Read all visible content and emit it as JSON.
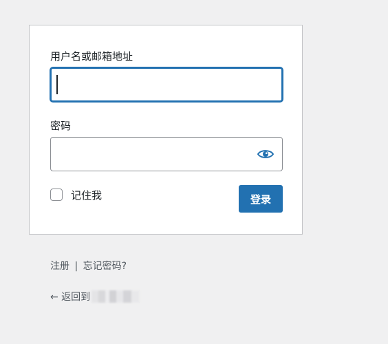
{
  "login_form": {
    "username_label": "用户名或邮箱地址",
    "username_value": "",
    "password_label": "密码",
    "password_value": "",
    "remember_label": "记住我",
    "remember_checked": false,
    "submit_label": "登录"
  },
  "nav": {
    "register_label": "注册",
    "separator": "|",
    "lost_password_label": "忘记密码?",
    "back_to_site_label": "← 返回到"
  },
  "colors": {
    "accent": "#2271b1",
    "background": "#f0f0f1",
    "card": "#ffffff",
    "text": "#1d2327",
    "muted_text": "#50575e"
  },
  "icons": {
    "password_toggle": "eye-icon"
  }
}
